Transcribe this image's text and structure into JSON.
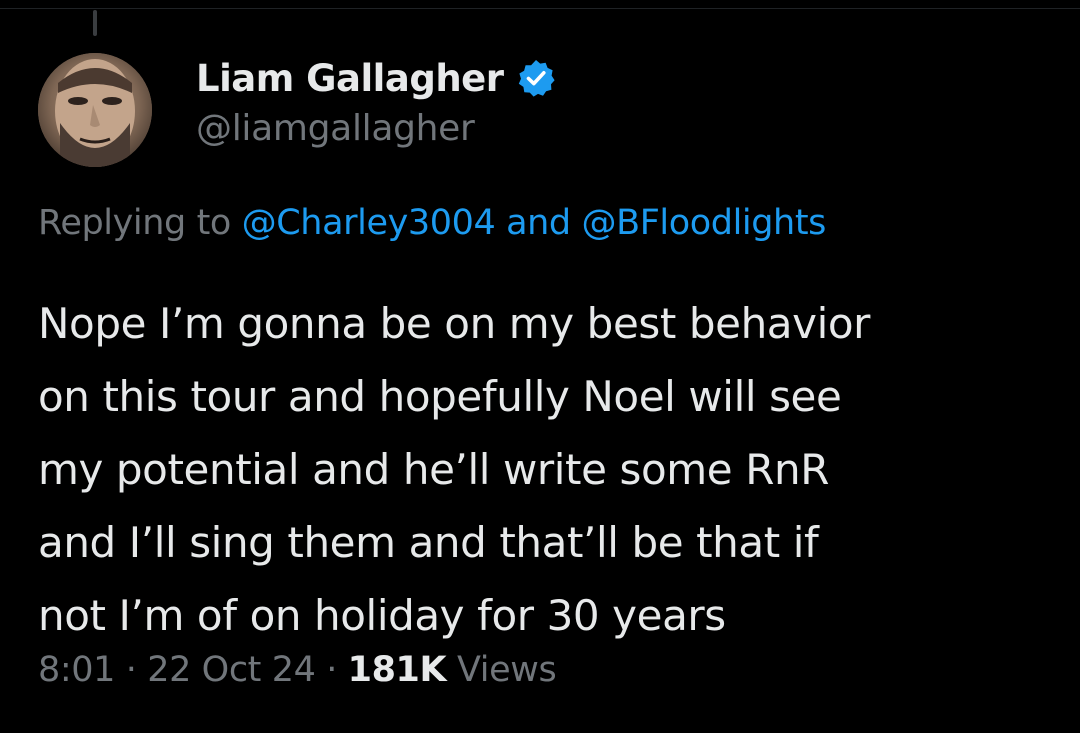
{
  "author": {
    "display_name": "Liam Gallagher",
    "handle": "@liamgallagher",
    "verified": true,
    "avatar_icon": "profile-photo"
  },
  "reply": {
    "prefix": "Replying to",
    "mention_1": "@Charley3004",
    "joiner": "and",
    "mention_2": "@BFloodlights"
  },
  "tweet": {
    "lines": [
      "Nope I’m gonna be on my best behavior",
      "on this tour and hopefully Noel will see",
      "my potential and he’ll write some RnR",
      "and I’ll sing them and that’ll be that if",
      "not I’m of on holiday for 30 years"
    ]
  },
  "meta": {
    "time": "8:01",
    "separator": "·",
    "date": "22 Oct 24",
    "views_count": "181K",
    "views_label": "Views"
  },
  "colors": {
    "background": "#000000",
    "text_primary": "#e7e9ea",
    "text_secondary": "#71767b",
    "accent": "#1d9bf0"
  }
}
